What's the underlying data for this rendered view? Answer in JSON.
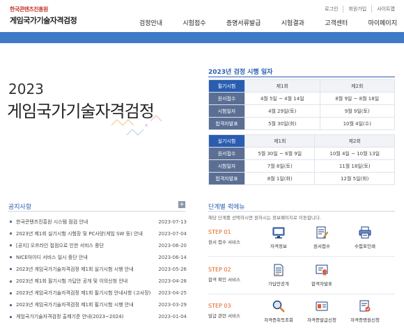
{
  "header": {
    "org": "한국콘텐츠진흥원",
    "title": "게임국가기술자격검정",
    "util": [
      "로그인",
      "회원가입",
      "사이트맵"
    ],
    "gnb": [
      "검정안내",
      "시험접수",
      "증명서류발급",
      "시험결과",
      "고객센터",
      "마이페이지"
    ]
  },
  "hero": {
    "year": "2023",
    "title": "게임국가기술자격검정"
  },
  "schedule": {
    "title": "2023년 검정 시행 일자",
    "written": {
      "label": "필기시험",
      "cols": [
        "제1회",
        "제2회"
      ],
      "rows": [
        {
          "label": "원서접수",
          "v1": "4월 5일 ~ 4월 14일",
          "v2": "8월 9일 ~ 8월 18일"
        },
        {
          "label": "시험일자",
          "v1": "4월 29일(토)",
          "v2": "9월 9일(토)"
        },
        {
          "label": "합격자발표",
          "v1": "5월 30일(화)",
          "v2": "10월 4일(수)"
        }
      ]
    },
    "practical": {
      "label": "실기시험",
      "cols": [
        "제1회",
        "제2회"
      ],
      "rows": [
        {
          "label": "원서접수",
          "v1": "5월 30일 ~ 6월 9일",
          "v2": "10월 4일 ~ 10월 13일"
        },
        {
          "label": "시험일자",
          "v1": "7월 8일(토)",
          "v2": "11월 18일(토)"
        },
        {
          "label": "합격자발표",
          "v1": "8월 1일(화)",
          "v2": "12월 5일(화)"
        }
      ]
    }
  },
  "notice": {
    "title": "공지사항",
    "more": "+",
    "items": [
      {
        "title": "한국콘텐츠진흥원 시스템 점검 안내",
        "date": "2023-07-13"
      },
      {
        "title": "2023년 제1회 실기시험 시험장 및 PC사양(게임 SW 등) 안내",
        "date": "2023-07-04"
      },
      {
        "title": "[공지] 오프라인 접점으로 인한 서비스 중단",
        "date": "2023-06-20"
      },
      {
        "title": "NICE아이디 서비스 일시 중단 안내",
        "date": "2023-06-14"
      },
      {
        "title": "2023년 게임국가기술자격검정 제1회 실기시험 시행 안내",
        "date": "2023-05-26"
      },
      {
        "title": "2023년 제1회 필기시험 가답안 공개 및 이의신청 안내",
        "date": "2023-04-28"
      },
      {
        "title": "2023년 게임국가기술자격검정 제1회 필기시험 안내사항 (고사장)",
        "date": "2023-04-25"
      },
      {
        "title": "2023년 게임국가기술자격검정 제1회 필기시험 시행 안내",
        "date": "2023-03-29"
      },
      {
        "title": "게임국가기술자격검정 출제기준 안내(2023~2024)",
        "date": "2023-01-04"
      }
    ]
  },
  "quick": {
    "title": "단계별 퀵메뉴",
    "subtitle": "해당 단계를 선택하시면 원하시는 정보페이지로 이동합니다.",
    "steps": [
      {
        "num": "STEP 01",
        "desc": "원서 접수 서비스",
        "items": [
          {
            "label": "자격정보",
            "icon": "monitor-icon"
          },
          {
            "label": "원서접수",
            "icon": "document-pen-icon"
          },
          {
            "label": "수험표인쇄",
            "icon": "printer-icon"
          }
        ]
      },
      {
        "num": "STEP 02",
        "desc": "합격 확인 서비스",
        "items": [
          {
            "label": "가답안공개",
            "icon": "document-icon"
          },
          {
            "label": "합격자발표",
            "icon": "certificate-icon"
          }
        ]
      },
      {
        "num": "STEP 03",
        "desc": "발급 관련 서비스",
        "items": [
          {
            "label": "자격증취득조회",
            "icon": "search-icon"
          },
          {
            "label": "자격증발급신청",
            "icon": "card-icon"
          },
          {
            "label": "자격증명원신청",
            "icon": "stamp-document-icon"
          }
        ]
      }
    ]
  },
  "colors": {
    "brand_blue": "#2a5db0",
    "bar_blue": "#3f7ac8",
    "step_orange": "#e0601b"
  }
}
